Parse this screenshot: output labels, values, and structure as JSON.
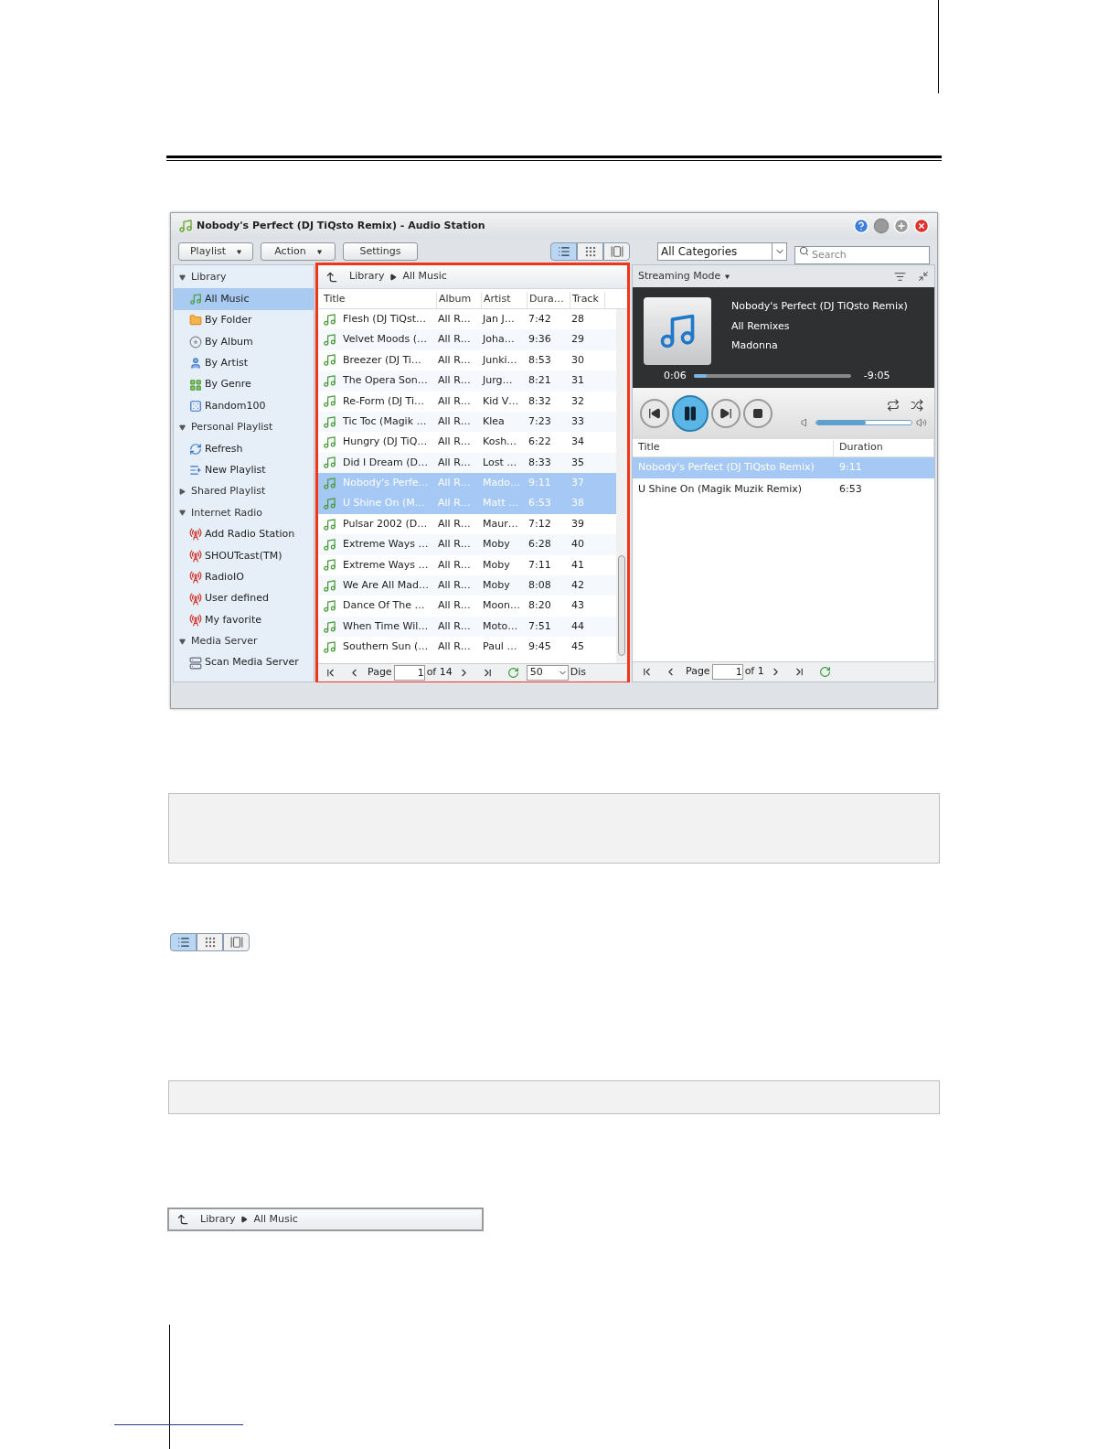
{
  "window": {
    "title": "Nobody's Perfect (DJ TiQsto Remix) - Audio Station"
  },
  "toolbar": {
    "buttons": [
      {
        "label": "Playlist",
        "kind": "dropdown"
      },
      {
        "label": "Action",
        "kind": "dropdown"
      },
      {
        "label": "Settings",
        "kind": "plain"
      }
    ],
    "view_modes": [
      {
        "kind": "list",
        "selected": true
      },
      {
        "kind": "grid",
        "selected": false
      },
      {
        "kind": "flow",
        "selected": false
      }
    ],
    "category": "All Categories",
    "search": {
      "placeholder": "Search"
    }
  },
  "sidebar": {
    "sections": [
      {
        "label": "Library",
        "expanded": true,
        "items": [
          {
            "label": "All Music",
            "kind": "music",
            "selected": true
          },
          {
            "label": "By Folder",
            "kind": "folder",
            "selected": false
          },
          {
            "label": "By Album",
            "kind": "album",
            "selected": false
          },
          {
            "label": "By Artist",
            "kind": "artist",
            "selected": false
          },
          {
            "label": "By Genre",
            "kind": "genre",
            "selected": false
          },
          {
            "label": "Random100",
            "kind": "random",
            "selected": false
          }
        ]
      },
      {
        "label": "Personal Playlist",
        "expanded": true,
        "items": [
          {
            "label": "Refresh",
            "kind": "refresh",
            "selected": false
          },
          {
            "label": "New Playlist",
            "kind": "new-playlist",
            "selected": false
          }
        ]
      },
      {
        "label": "Shared Playlist",
        "expanded": false
      },
      {
        "label": "Internet Radio",
        "expanded": true,
        "items": [
          {
            "label": "Add Radio Station",
            "kind": "radio-add",
            "selected": false
          },
          {
            "label": "SHOUTcast(TM)",
            "kind": "radio",
            "selected": false
          },
          {
            "label": "RadioIO",
            "kind": "radio",
            "selected": false
          },
          {
            "label": "User defined",
            "kind": "radio",
            "selected": false
          },
          {
            "label": "My favorite",
            "kind": "radio",
            "selected": false
          }
        ]
      },
      {
        "label": "Media Server",
        "expanded": true,
        "items": [
          {
            "label": "Scan Media Server",
            "kind": "server",
            "selected": false
          }
        ]
      }
    ]
  },
  "browser": {
    "breadcrumb": [
      "Library",
      "All Music"
    ],
    "columns": [
      "Title",
      "Album",
      "Artist",
      "Dura…",
      "Track"
    ],
    "rows": [
      {
        "cells": [
          "Flesh (DJ TiQst…",
          "All R…",
          "Jan J…",
          "7:42",
          "28"
        ],
        "selected": false
      },
      {
        "cells": [
          "Velvet Moods (…",
          "All R…",
          "Joha…",
          "9:36",
          "29"
        ],
        "selected": false
      },
      {
        "cells": [
          "Breezer (DJ Ti…",
          "All R…",
          "Junki…",
          "8:53",
          "30"
        ],
        "selected": false
      },
      {
        "cells": [
          "The Opera Son…",
          "All R…",
          "Jurg…",
          "8:21",
          "31"
        ],
        "selected": false
      },
      {
        "cells": [
          "Re-Form (DJ Ti…",
          "All R…",
          "Kid V…",
          "8:32",
          "32"
        ],
        "selected": false
      },
      {
        "cells": [
          "Tic Toc (Magik …",
          "All R…",
          "Klea",
          "7:23",
          "33"
        ],
        "selected": false
      },
      {
        "cells": [
          "Hungry (DJ TiQ…",
          "All R…",
          "Kosh…",
          "6:22",
          "34"
        ],
        "selected": false
      },
      {
        "cells": [
          "Did I Dream (D…",
          "All R…",
          "Lost …",
          "8:33",
          "35"
        ],
        "selected": false
      },
      {
        "cells": [
          "Nobody's Perfe…",
          "All R…",
          "Mado…",
          "9:11",
          "37"
        ],
        "selected": true
      },
      {
        "cells": [
          "U Shine On (M…",
          "All R…",
          "Matt …",
          "6:53",
          "38"
        ],
        "selected": true
      },
      {
        "cells": [
          "Pulsar 2002 (D…",
          "All R…",
          "Maur…",
          "7:12",
          "39"
        ],
        "selected": false
      },
      {
        "cells": [
          "Extreme Ways …",
          "All R…",
          "Moby",
          "6:28",
          "40"
        ],
        "selected": false
      },
      {
        "cells": [
          "Extreme Ways …",
          "All R…",
          "Moby",
          "7:11",
          "41"
        ],
        "selected": false
      },
      {
        "cells": [
          "We Are All Mad…",
          "All R…",
          "Moby",
          "8:08",
          "42"
        ],
        "selected": false
      },
      {
        "cells": [
          "Dance Of The …",
          "All R…",
          "Moon…",
          "8:20",
          "43"
        ],
        "selected": false
      },
      {
        "cells": [
          "When Time Wil…",
          "All R…",
          "Moto…",
          "7:51",
          "44"
        ],
        "selected": false
      },
      {
        "cells": [
          "Southern Sun (…",
          "All R…",
          "Paul …",
          "9:45",
          "45"
        ],
        "selected": false
      }
    ],
    "pager": {
      "label": "Page",
      "page": "1",
      "total": "of 14",
      "per_page": "50",
      "trailing": "Dis"
    }
  },
  "player": {
    "mode": "Streaming Mode",
    "track": {
      "title": "Nobody's Perfect (DJ TiQsto Remix)",
      "album": "All Remixes",
      "artist": "Madonna"
    },
    "elapsed": "0:06",
    "remaining": "-9:05",
    "progress": {
      "level": 0.03
    },
    "playing": true,
    "volume": {
      "level": 0.52
    },
    "playlist": {
      "columns": [
        "Title",
        "Duration"
      ],
      "rows": [
        {
          "cells": [
            "Nobody's Perfect (DJ TiQsto Remix)",
            "9:11"
          ],
          "selected": true
        },
        {
          "cells": [
            "U Shine On (Magik Muzik Remix)",
            "6:53"
          ],
          "selected": false
        }
      ]
    },
    "pager": {
      "label": "Page",
      "page": "1",
      "total": "of 1"
    }
  },
  "legend": {
    "view_modes": [
      {
        "kind": "list",
        "selected": true
      },
      {
        "kind": "grid",
        "selected": false
      },
      {
        "kind": "flow",
        "selected": false
      }
    ],
    "breadcrumb": [
      "Library",
      "All Music"
    ]
  }
}
